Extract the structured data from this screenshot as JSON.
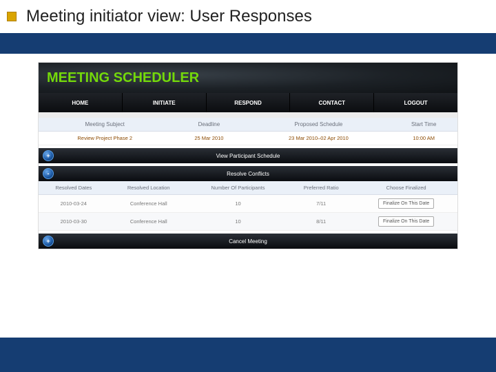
{
  "slide": {
    "title": "Meeting initiator view: User Responses"
  },
  "brand": "MEETING SCHEDULER",
  "nav": [
    "HOME",
    "INITIATE",
    "RESPOND",
    "CONTACT",
    "LOGOUT"
  ],
  "meeting_table": {
    "headers": [
      "Meeting Subject",
      "Deadline",
      "Proposed Schedule",
      "Start Time"
    ],
    "row": {
      "subject": "Review Project Phase 2",
      "deadline": "25 Mar 2010",
      "proposed": "23 Mar 2010–02 Apr 2010",
      "start": "10:00 AM"
    }
  },
  "bars": {
    "view_participant": {
      "sign": "+",
      "label": "View Participant Schedule"
    },
    "resolve": {
      "sign": "-",
      "label": "Resolve Conflicts"
    },
    "cancel": {
      "sign": "+",
      "label": "Cancel Meeting"
    }
  },
  "resolve_table": {
    "headers": [
      "Resolved Dates",
      "Resolved Location",
      "Number Of Participants",
      "Preferred Ratio",
      "Choose Finalized"
    ],
    "rows": [
      {
        "date": "2010-03-24",
        "location": "Conference Hall",
        "participants": "10",
        "ratio": "7/11",
        "button": "Finalize On This Date"
      },
      {
        "date": "2010-03-30",
        "location": "Conference Hall",
        "participants": "10",
        "ratio": "8/11",
        "button": "Finalize On This Date"
      }
    ]
  }
}
